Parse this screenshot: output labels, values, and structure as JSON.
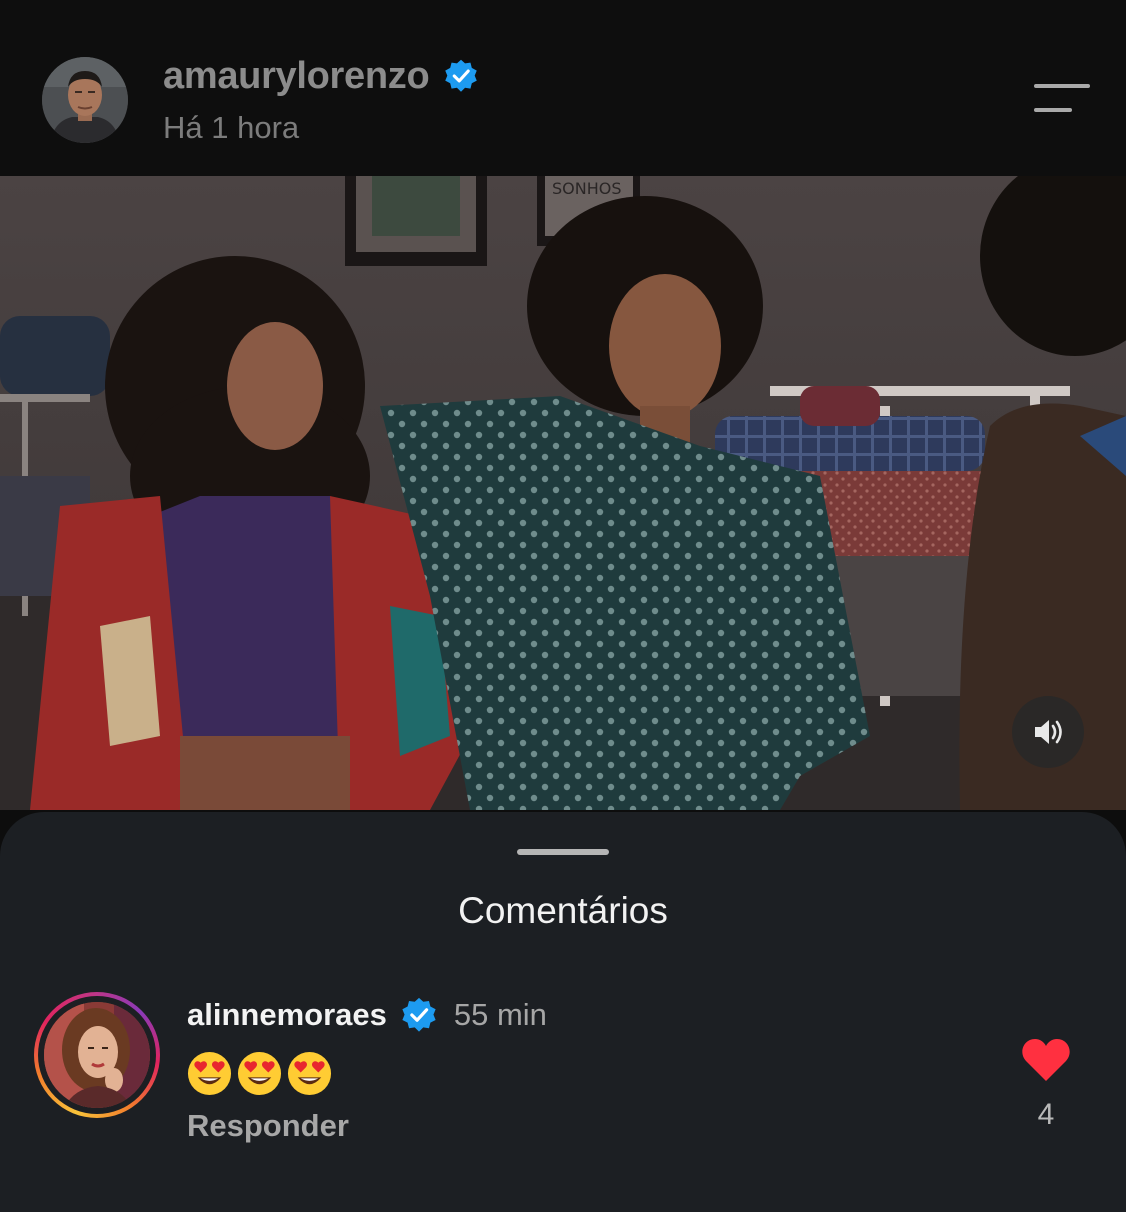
{
  "post": {
    "username": "amaurylorenzo",
    "time": "Há 1 hora",
    "verified": true
  },
  "video": {
    "poster_text": "SONHOS",
    "muted": false
  },
  "comments_sheet": {
    "title": "Comentários",
    "comments": [
      {
        "username": "alinnemoraes",
        "verified": true,
        "time": "55 min",
        "text": "😍😍😍",
        "reply_label": "Responder",
        "likes": "4",
        "liked": true
      }
    ]
  },
  "icons": {
    "verified": "verified-badge-icon",
    "menu": "menu-icon",
    "sound": "speaker-icon",
    "like": "heart-icon"
  },
  "colors": {
    "verified": "#1d9bf0",
    "like": "#ff3040",
    "sheet_bg": "#1c1f23",
    "header_bg": "#0e0e0e"
  }
}
